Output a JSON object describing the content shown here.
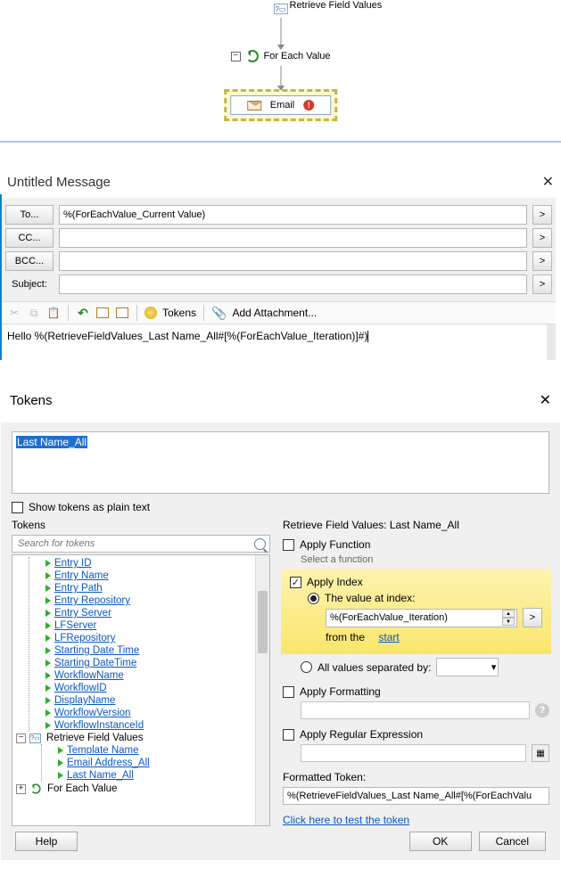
{
  "workflow": {
    "retrieve_label": "Retrieve Field Values",
    "foreach_label": "For Each Value",
    "email_label": "Email"
  },
  "email_panel": {
    "title": "Untitled Message",
    "to_btn": "To...",
    "cc_btn": "CC...",
    "bcc_btn": "BCC...",
    "subject_label": "Subject:",
    "to_value": "%(ForEachValue_Current Value)",
    "cc_value": "",
    "bcc_value": "",
    "subject_value": "",
    "tokens_btn": "Tokens",
    "attach_btn": "Add Attachment...",
    "body": "Hello %(RetrieveFieldValues_Last Name_All#[%(ForEachValue_Iteration)]#)"
  },
  "tokens": {
    "title": "Tokens",
    "textarea_value": "Last Name_All",
    "show_plain": "Show tokens as plain text",
    "tokens_label": "Tokens",
    "search_placeholder": "Search for tokens",
    "tree_root_items": [
      "Entry ID",
      "Entry Name",
      "Entry Path",
      "Entry Repository",
      "Entry Server",
      "LFServer",
      "LFRepository",
      "Starting Date Time",
      "Starting DateTime",
      "WorkflowName",
      "WorkflowID",
      "DisplayName",
      "WorkflowVersion",
      "WorkflowInstanceId"
    ],
    "tree_group1": "Retrieve Field Values",
    "tree_group1_items": [
      "Template Name",
      "Email Address_All",
      "Last Name_All"
    ],
    "tree_group2": "For Each Value",
    "right_heading": "Retrieve Field Values: Last Name_All",
    "apply_function": "Apply Function",
    "select_function": "Select a function",
    "apply_index": "Apply Index",
    "value_at_index": "The value at index:",
    "index_value": "%(ForEachValue_Iteration)",
    "from_the": "from the",
    "start_link": "start",
    "all_values_sep": "All values separated by:",
    "apply_formatting": "Apply Formatting",
    "apply_regex": "Apply Regular Expression",
    "formatted_label": "Formatted Token:",
    "formatted_value": "%(RetrieveFieldValues_Last Name_All#[%(ForEachValu",
    "test_link": "Click here to test the token",
    "help_btn": "Help",
    "ok_btn": "OK",
    "cancel_btn": "Cancel"
  }
}
